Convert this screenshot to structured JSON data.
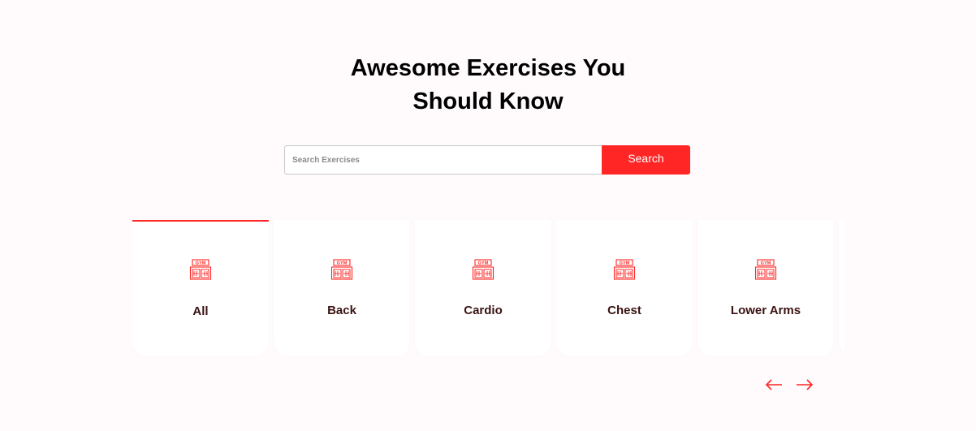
{
  "hero": {
    "title_line1": "Awesome Exercises You",
    "title_line2": "Should Know"
  },
  "search": {
    "placeholder": "Search Exercises",
    "value": "",
    "button_label": "Search"
  },
  "categories": {
    "items": [
      {
        "label": "All",
        "icon": "gym-icon",
        "active": true
      },
      {
        "label": "Back",
        "icon": "gym-icon",
        "active": false
      },
      {
        "label": "Cardio",
        "icon": "gym-icon",
        "active": false
      },
      {
        "label": "Chest",
        "icon": "gym-icon",
        "active": false
      },
      {
        "label": "Lower Arms",
        "icon": "gym-icon",
        "active": false
      }
    ]
  },
  "pagination": {
    "prev_icon": "arrow-left-icon",
    "next_icon": "arrow-right-icon"
  },
  "colors": {
    "accent": "#ff2625",
    "background": "#fffafb",
    "card_label": "#3a1212"
  }
}
